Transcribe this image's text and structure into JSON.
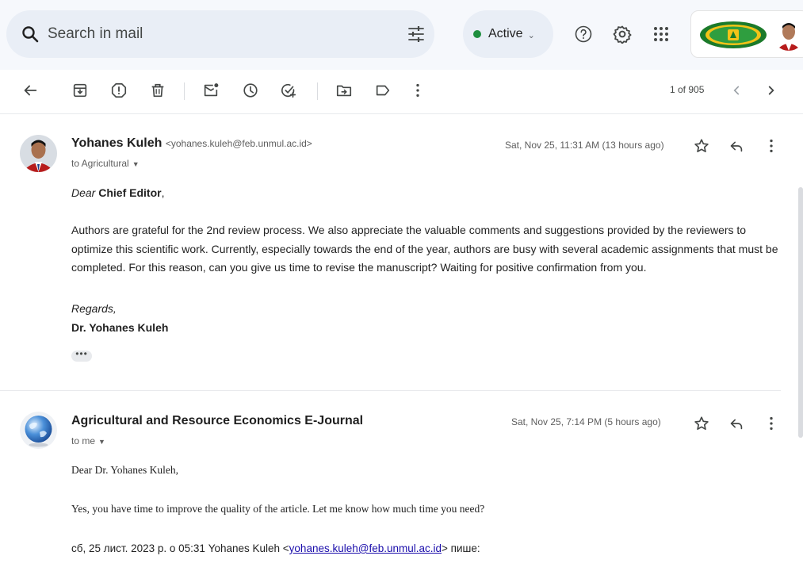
{
  "search": {
    "placeholder": "Search in mail"
  },
  "status": {
    "label": "Active"
  },
  "toolbar": {
    "pager_text": "1 of 905"
  },
  "messages": [
    {
      "sender_name": "Yohanes Kuleh",
      "sender_email": "<yohanes.kuleh@feb.unmul.ac.id>",
      "to_line": "to Agricultural",
      "date": "Sat, Nov 25, 11:31 AM (13 hours ago)",
      "greeting_prefix": "Dear",
      "greeting_name": "Chief Editor",
      "greeting_suffix": ",",
      "paragraph": "Authors are grateful for the 2nd review process. We also appreciate the valuable comments and suggestions provided by the reviewers to optimize this scientific work. Currently, especially towards the end of the year, authors are busy with several academic assignments that must be completed. For this reason, can you give us time to revise the manuscript? Waiting for positive confirmation from you.",
      "signoff": "Regards,",
      "signature": "Dr. Yohanes Kuleh",
      "ellipsis": "•••"
    },
    {
      "sender_name": "Agricultural and Resource Economics E-Journal",
      "to_line": "to me",
      "date": "Sat, Nov 25, 7:14 PM (5 hours ago)",
      "greeting": "Dear Dr. Yohanes Kuleh,",
      "paragraph": "Yes, you have time to improve the quality of the article. Let me know how much time you need?",
      "quote_prefix": "сб, 25 лист. 2023 р. о 05:31 Yohanes Kuleh <",
      "quote_email": "yohanes.kuleh@feb.unmul.ac.id",
      "quote_suffix": "> пише:"
    }
  ],
  "icons": {
    "topbar": [
      "search-icon",
      "filter-options-icon",
      "chevron-down-icon",
      "help-icon",
      "settings-gear-icon",
      "apps-grid-icon",
      "organization-logo",
      "account-avatar"
    ],
    "toolbar": [
      "back-arrow-icon",
      "archive-icon",
      "report-spam-icon",
      "delete-icon",
      "mark-unread-icon",
      "snooze-icon",
      "add-to-tasks-icon",
      "move-to-icon",
      "label-icon",
      "more-vert-icon",
      "chevron-left-icon",
      "chevron-right-icon"
    ],
    "message": [
      "star-icon",
      "reply-icon",
      "more-vert-icon"
    ]
  },
  "colors": {
    "active_dot": "#1e8e3e",
    "topbar_bg": "#f6f8fc",
    "search_bg": "#e9eef6",
    "link": "#1a0dab"
  }
}
